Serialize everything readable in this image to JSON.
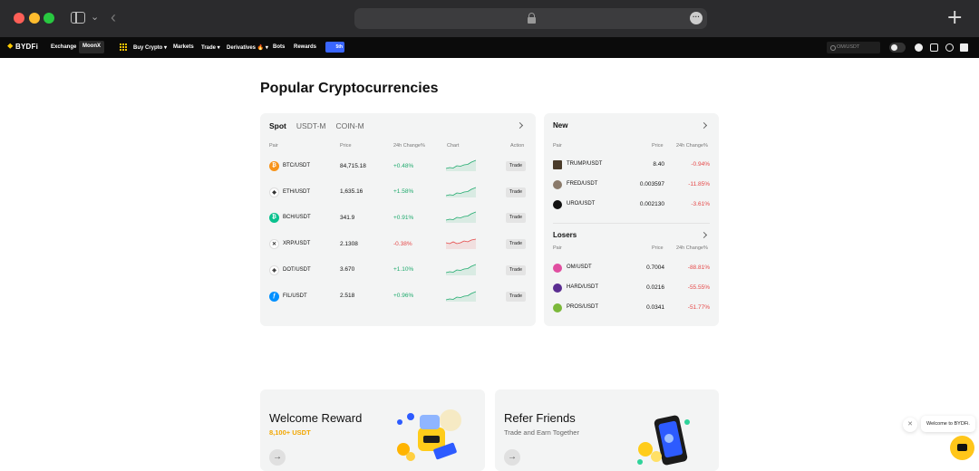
{
  "browser": {
    "add_tab": "+"
  },
  "nav": {
    "logo_prefix": "⯁",
    "logo": "BYDFi",
    "items": [
      "Exchange",
      "MoonX",
      "Buy Crypto ▾",
      "Markets",
      "Trade ▾",
      "Derivatives 🔥 ▾",
      "Bots",
      "Rewards"
    ],
    "promo": "5th",
    "search_placeholder": "OM/USDT"
  },
  "page": {
    "title": "Popular Cryptocurrencies"
  },
  "main_card": {
    "tabs": [
      "Spot",
      "USDT-M",
      "COIN-M"
    ],
    "columns": [
      "Pair",
      "Price",
      "24h Change%",
      "Chart",
      "Action"
    ],
    "trade_label": "Trade",
    "rows": [
      {
        "pair": "BTC/USDT",
        "price": "84,715.18",
        "change": "+0.48%",
        "dir": "up",
        "icon": "btc-icon",
        "icon_char": "₿",
        "color": "#f7931a"
      },
      {
        "pair": "ETH/USDT",
        "price": "1,635.16",
        "change": "+1.58%",
        "dir": "up",
        "icon": "eth-icon",
        "icon_char": "◆",
        "color": "#ffffff"
      },
      {
        "pair": "BCH/USDT",
        "price": "341.9",
        "change": "+0.91%",
        "dir": "up",
        "icon": "bch-icon",
        "icon_char": "₿",
        "color": "#0ac18e"
      },
      {
        "pair": "XRP/USDT",
        "price": "2.1308",
        "change": "-0.38%",
        "dir": "down",
        "icon": "xrp-icon",
        "icon_char": "✕",
        "color": "#ffffff"
      },
      {
        "pair": "DOT/USDT",
        "price": "3.670",
        "change": "+1.10%",
        "dir": "up",
        "icon": "dot-icon",
        "icon_char": "◈",
        "color": "#ffffff"
      },
      {
        "pair": "FIL/USDT",
        "price": "2.518",
        "change": "+0.96%",
        "dir": "up",
        "icon": "fil-icon",
        "icon_char": "ƒ",
        "color": "#0090ff"
      }
    ]
  },
  "new_card": {
    "title": "New",
    "columns": [
      "Pair",
      "Price",
      "24h Change%"
    ],
    "rows": [
      {
        "pair": "TRUMP/USDT",
        "price": "8.40",
        "change": "-0.94%",
        "icon": "trump-icon",
        "color": "#4a3b2a"
      },
      {
        "pair": "FRED/USDT",
        "price": "0.003597",
        "change": "-11.85%",
        "icon": "fred-icon",
        "color": "#8a7a6a"
      },
      {
        "pair": "URO/USDT",
        "price": "0.002130",
        "change": "-3.61%",
        "icon": "uro-icon",
        "color": "#111111"
      }
    ]
  },
  "losers_card": {
    "title": "Losers",
    "columns": [
      "Pair",
      "Price",
      "24h Change%"
    ],
    "rows": [
      {
        "pair": "OM/USDT",
        "price": "0.7004",
        "change": "-88.81%",
        "icon": "om-icon",
        "color": "#e04ea0"
      },
      {
        "pair": "HARD/USDT",
        "price": "0.0216",
        "change": "-55.55%",
        "icon": "hard-icon",
        "color": "#5a2d91"
      },
      {
        "pair": "PROS/USDT",
        "price": "0.0341",
        "change": "-51.77%",
        "icon": "pros-icon",
        "color": "#7bb83a"
      }
    ]
  },
  "promo_cards": [
    {
      "title": "Welcome Reward",
      "subtitle": "8,100+ USDT"
    },
    {
      "title": "Refer Friends",
      "subtitle": "Trade and Earn Together"
    }
  ],
  "chat": {
    "bubble": "Welcome to BYDFi.",
    "close": "✕"
  }
}
